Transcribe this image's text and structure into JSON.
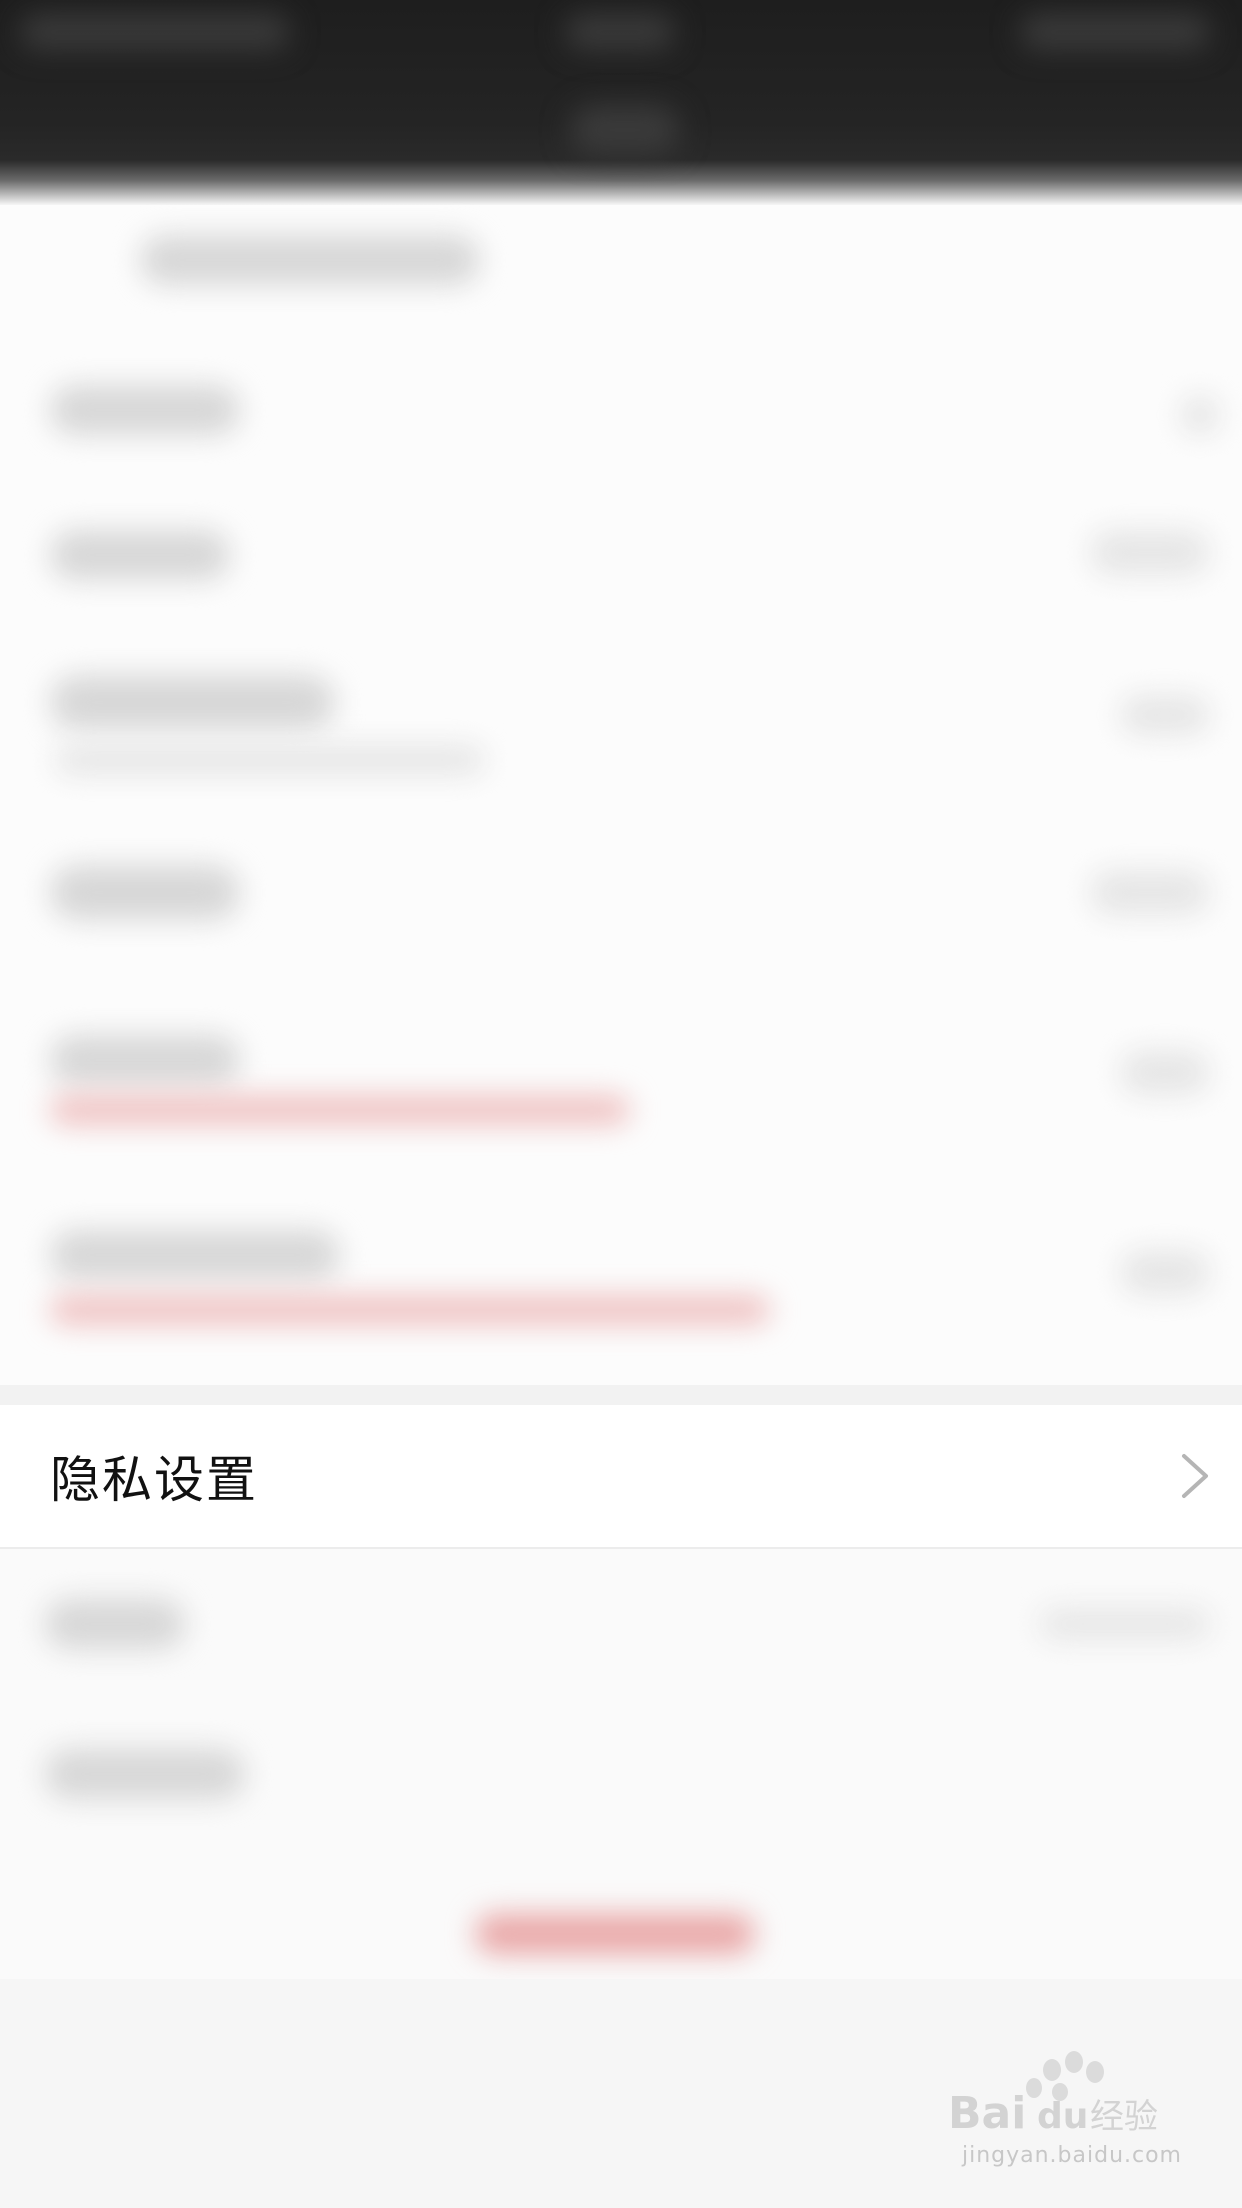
{
  "privacy_settings": {
    "label": "隐私设置",
    "chevron_icon": "chevron-right-icon"
  },
  "watermark": {
    "brand": "Bai du 经验",
    "url": "jingyan.baidu.com"
  },
  "colors": {
    "header_bg": "#1e1e1e",
    "accent_red": "#e9a7a7",
    "row_bg": "#ffffff",
    "separator": "#ececec"
  }
}
